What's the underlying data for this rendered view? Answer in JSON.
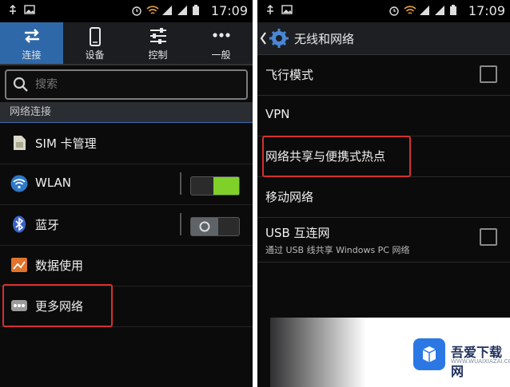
{
  "left": {
    "status_time": "17:09",
    "tabs": [
      {
        "label": "连接",
        "icon": "swap-arrows-icon"
      },
      {
        "label": "设备",
        "icon": "phone-icon"
      },
      {
        "label": "控制",
        "icon": "sliders-icon"
      },
      {
        "label": "一般",
        "icon": "more-dots-icon"
      }
    ],
    "search_placeholder": "搜索",
    "section_header": "网络连接",
    "rows": [
      {
        "label": "SIM 卡管理",
        "icon": "sim-card-icon"
      },
      {
        "label": "WLAN",
        "icon": "wifi-icon",
        "toggle": "on"
      },
      {
        "label": "蓝牙",
        "icon": "bluetooth-icon",
        "toggle": "off"
      },
      {
        "label": "数据使用",
        "icon": "data-usage-icon"
      },
      {
        "label": "更多网络",
        "icon": "more-networks-icon"
      }
    ]
  },
  "right": {
    "status_time": "17:09",
    "title": "无线和网络",
    "rows": [
      {
        "label": "飞行模式",
        "checkbox": true
      },
      {
        "label": "VPN"
      },
      {
        "label": "网络共享与便携式热点"
      },
      {
        "label": "移动网络"
      },
      {
        "label": "USB 互连网",
        "sublabel": "通过 USB 线共享 Windows PC 网络",
        "checkbox": true
      }
    ]
  },
  "watermark": {
    "brand": "吾爱下载网",
    "sub": "WWW.WUAIXIAZAI.COM"
  },
  "colors": {
    "active_tab": "#2f68a8",
    "toggle_on": "#7fd12a",
    "highlight": "#d6302e"
  }
}
